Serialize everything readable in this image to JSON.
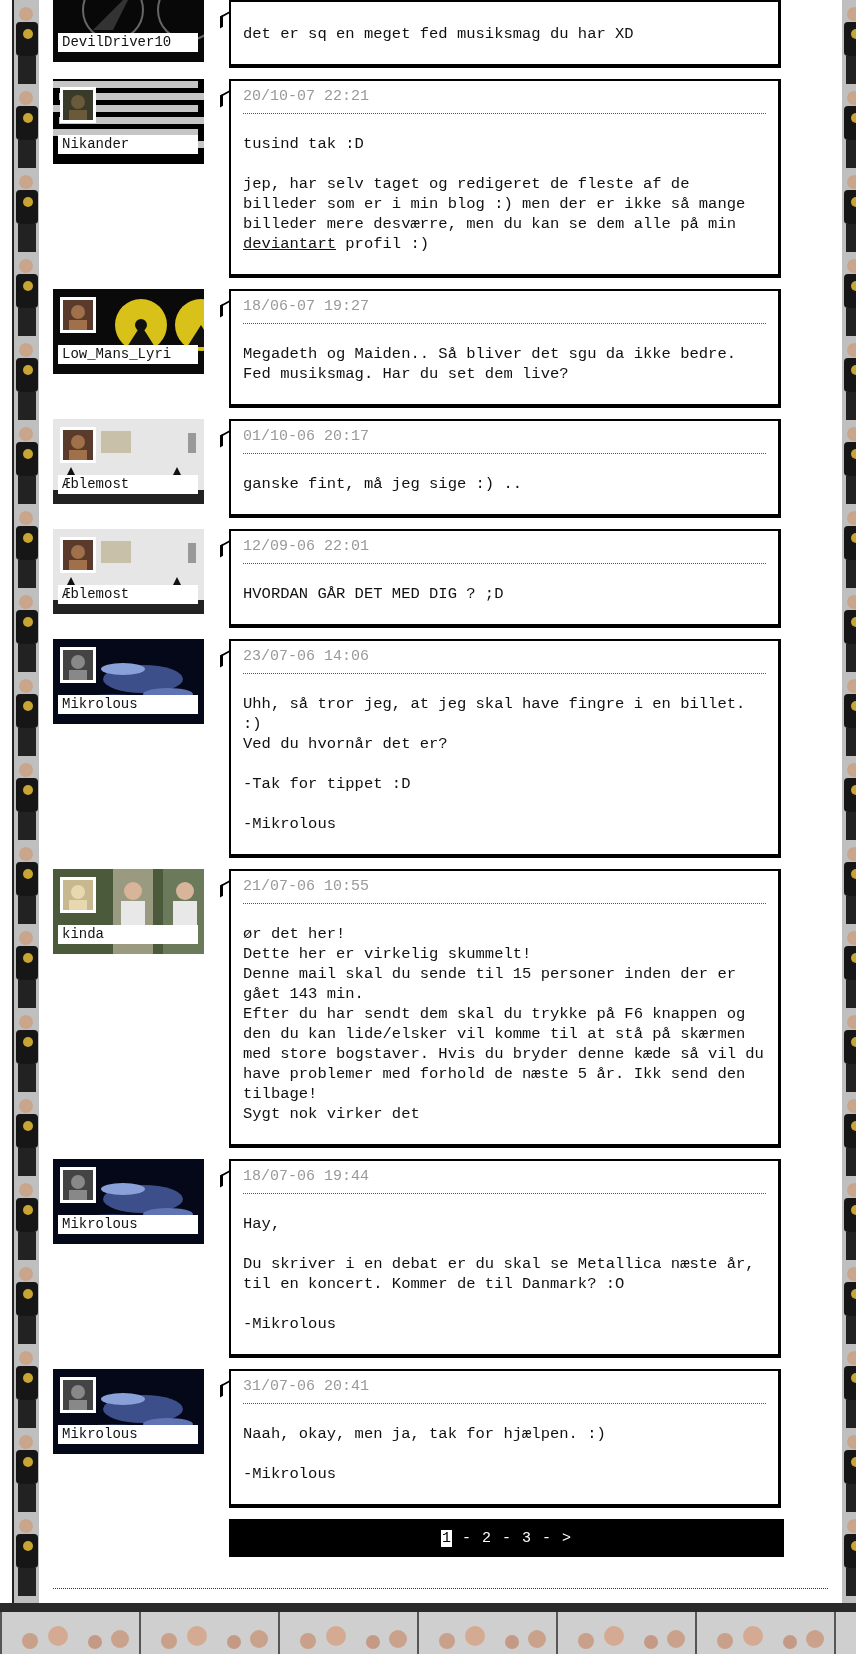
{
  "posts": [
    {
      "author": "DevilDriver10",
      "message": [
        [
          {
            "kind": "text",
            "text": "det er sq en meget fed musiksmag du har XD"
          }
        ]
      ]
    },
    {
      "author": "Nikander",
      "timestamp": "20/10-07 22:21",
      "message": [
        [
          {
            "kind": "text",
            "text": "tusind tak :D"
          }
        ],
        [
          {
            "kind": "text",
            "text": "jep, har selv taget og redigeret de fleste af de billeder som er i min blog :) men der er ikke så mange billeder mere desværre, men du kan se dem alle på min "
          },
          {
            "kind": "link",
            "text": "deviantart"
          },
          {
            "kind": "text",
            "text": " profil :)"
          }
        ]
      ]
    },
    {
      "author": "Low_Mans_Lyri",
      "timestamp": "18/06-07 19:27",
      "message": [
        [
          {
            "kind": "text",
            "text": "Megadeth og Maiden.. Så bliver det sgu da ikke bedre. Fed musiksmag. Har du set dem live?"
          }
        ]
      ]
    },
    {
      "author": "Æblemost",
      "timestamp": "01/10-06 20:17",
      "message": [
        [
          {
            "kind": "text",
            "text": "ganske fint, må jeg sige :) .."
          }
        ]
      ]
    },
    {
      "author": "Æblemost",
      "timestamp": "12/09-06 22:01",
      "message": [
        [
          {
            "kind": "text",
            "text": "HVORDAN GÅR DET MED DIG ? ;D"
          }
        ]
      ]
    },
    {
      "author": "Mikrolous",
      "timestamp": "23/07-06 14:06",
      "message": [
        [
          {
            "kind": "text",
            "text": "Uhh, så tror jeg, at jeg skal have fingre i en billet. :)\nVed du hvornår det er?"
          }
        ],
        [
          {
            "kind": "text",
            "text": "-Tak for tippet :D"
          }
        ],
        [
          {
            "kind": "text",
            "text": "-Mikrolous"
          }
        ]
      ]
    },
    {
      "author": "kinda",
      "timestamp": "21/07-06 10:55",
      "message": [
        [
          {
            "kind": "text",
            "text": "ør det her!\nDette her er virkelig skummelt!\nDenne mail skal du sende til 15 personer inden der er gået 143 min.\nEfter du har sendt dem skal du trykke på F6 knappen og den du kan lide/elsker vil komme til at stå på skærmen med store bogstaver. Hvis du bryder denne kæde så vil du have problemer med forhold de næste 5 år. Ikk send den tilbage!\nSygt nok virker det"
          }
        ]
      ]
    },
    {
      "author": "Mikrolous",
      "timestamp": "18/07-06 19:44",
      "message": [
        [
          {
            "kind": "text",
            "text": "Hay,"
          }
        ],
        [
          {
            "kind": "text",
            "text": "Du skriver i en debat er du skal se Metallica næste år, til en koncert. Kommer de til Danmark? :O"
          }
        ],
        [
          {
            "kind": "text",
            "text": "-Mikrolous"
          }
        ]
      ]
    },
    {
      "author": "Mikrolous",
      "timestamp": "31/07-06 20:41",
      "message": [
        [
          {
            "kind": "text",
            "text": "Naah, okay, men ja, tak for hjælpen. :)"
          }
        ],
        [
          {
            "kind": "text",
            "text": "-Mikrolous"
          }
        ]
      ]
    }
  ],
  "pagination": {
    "separator": "-",
    "pages": [
      {
        "label": "1",
        "selected": true
      },
      {
        "label": "2",
        "selected": false
      },
      {
        "label": "3",
        "selected": false
      }
    ],
    "next": ">"
  }
}
